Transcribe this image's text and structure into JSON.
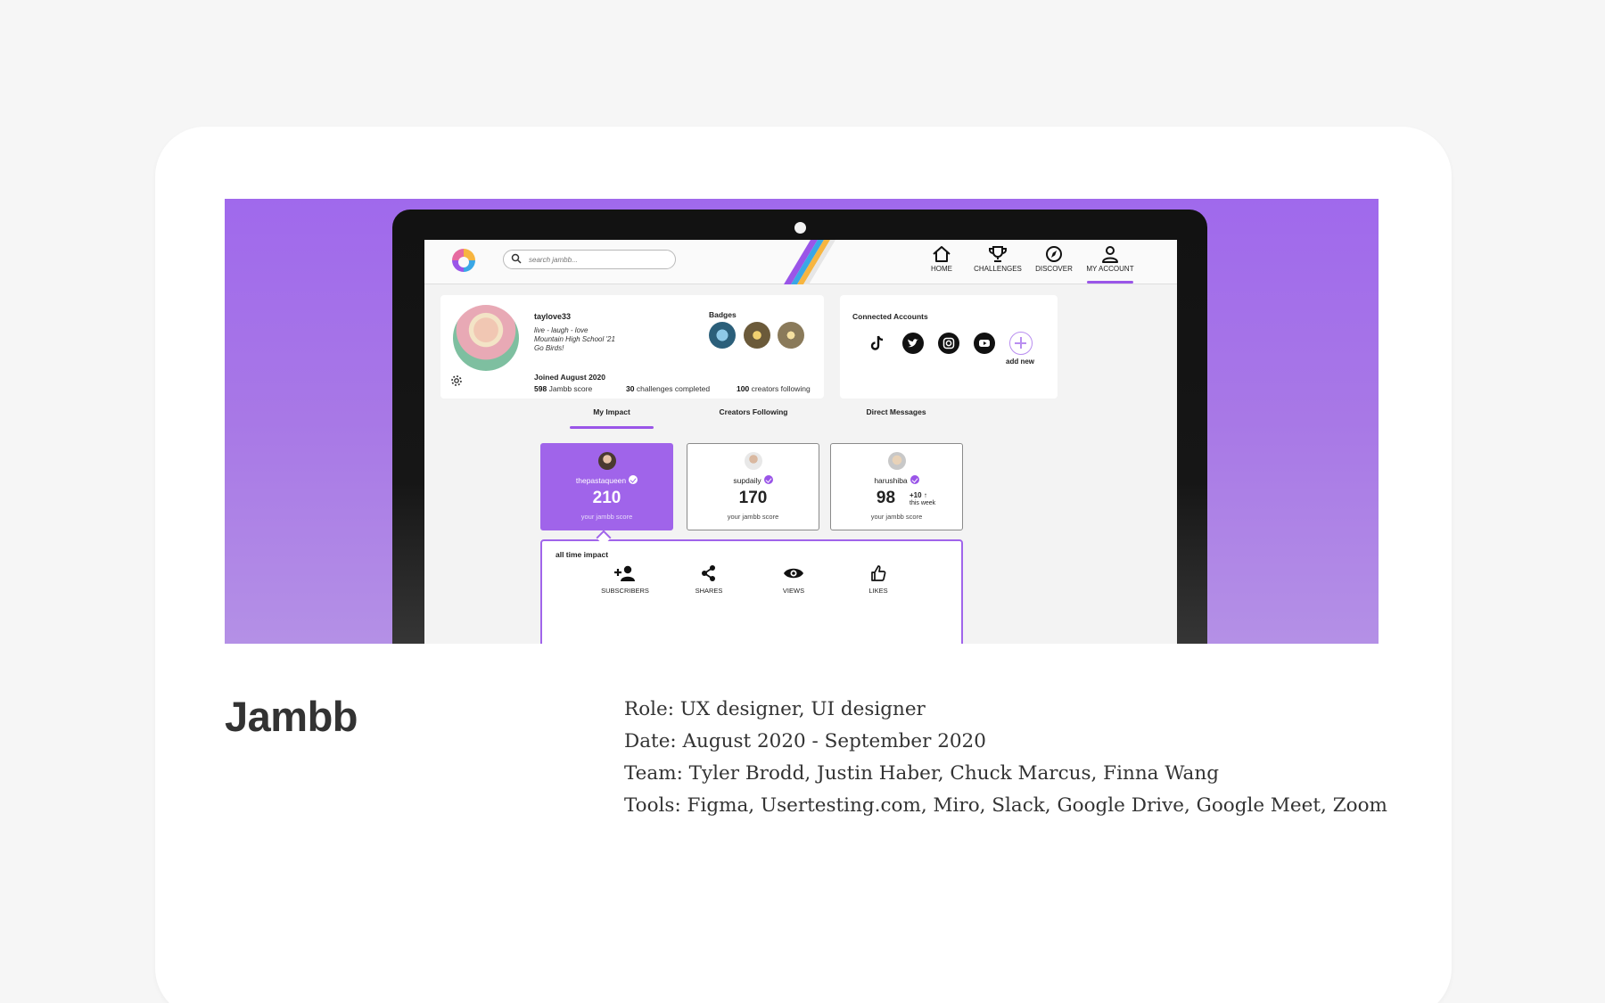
{
  "app": {
    "search_placeholder": "search jambb...",
    "nav": [
      {
        "label": "HOME",
        "icon": "home-icon"
      },
      {
        "label": "CHALLENGES",
        "icon": "trophy-icon"
      },
      {
        "label": "DISCOVER",
        "icon": "compass-icon"
      },
      {
        "label": "MY ACCOUNT",
        "icon": "user-icon",
        "active": true
      }
    ],
    "profile": {
      "username": "taylove33",
      "bio": [
        "live - laugh - love",
        "Mountain High School '21",
        "Go Birds!"
      ],
      "joined": "Joined August 2020",
      "score_value": "598",
      "score_label": "Jambb score",
      "challenges_value": "30",
      "challenges_label": "challenges completed",
      "following_value": "100",
      "following_label": "creators following",
      "badges_title": "Badges"
    },
    "connected": {
      "title": "Connected Accounts",
      "accounts": [
        "tiktok-icon",
        "twitter-icon",
        "instagram-icon",
        "youtube-icon"
      ],
      "add_label": "add new"
    },
    "tabs": [
      "My Impact",
      "Creators Following",
      "Direct Messages"
    ],
    "creators": [
      {
        "name": "thepastaqueen",
        "score": "210",
        "sub": "your jambb score",
        "selected": true
      },
      {
        "name": "supdaily",
        "score": "170",
        "sub": "your jambb score"
      },
      {
        "name": "harushiba",
        "score": "98",
        "sub": "your jambb score",
        "delta": "+10",
        "delta_label": "this week"
      }
    ],
    "impact": {
      "title": "all time impact",
      "metrics": [
        "SUBSCRIBERS",
        "SHARES",
        "VIEWS",
        "LIKES"
      ]
    }
  },
  "project": {
    "title": "Jambb",
    "role": "Role: UX designer, UI designer",
    "date": "Date: August 2020 - September 2020",
    "team": "Team: Tyler Brodd, Justin Haber, Chuck Marcus, Finna Wang",
    "tools": "Tools: Figma, Usertesting.com, Miro, Slack, Google Drive, Google Meet, Zoom"
  },
  "colors": {
    "accent": "#9a55e8",
    "hero_top": "#a069ec",
    "hero_bottom": "#b490e6",
    "card": "#ffffff",
    "page": "#f6f6f6"
  }
}
